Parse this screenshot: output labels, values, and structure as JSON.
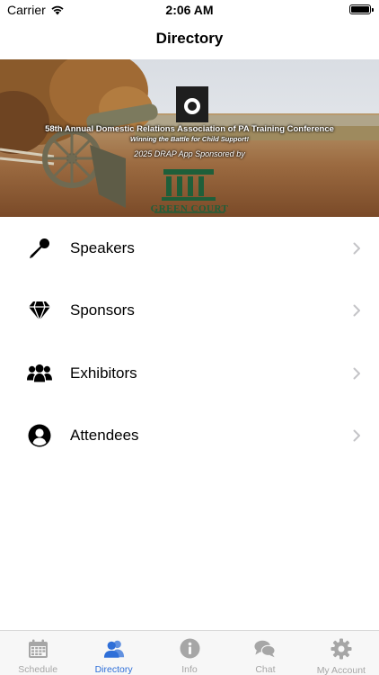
{
  "status_bar": {
    "carrier": "Carrier",
    "time": "2:06 AM"
  },
  "nav": {
    "title": "Directory"
  },
  "banner": {
    "title": "58th Annual Domestic Relations Association of PA Training Conference",
    "subtitle": "Winning the Battle for Child Support!",
    "sponsor_line": "2025 DRAP App Sponsored by",
    "sponsor_name": "GREEN COURT"
  },
  "directory": {
    "items": [
      {
        "label": "Speakers",
        "icon": "microphone-icon"
      },
      {
        "label": "Sponsors",
        "icon": "diamond-icon"
      },
      {
        "label": "Exhibitors",
        "icon": "people-icon"
      },
      {
        "label": "Attendees",
        "icon": "user-circle-icon"
      }
    ]
  },
  "tab_bar": {
    "active_color": "#2f6fd8",
    "inactive_color": "#a6a6a6",
    "tabs": [
      {
        "label": "Schedule",
        "icon": "calendar-icon",
        "active": false
      },
      {
        "label": "Directory",
        "icon": "people-icon",
        "active": true
      },
      {
        "label": "Info",
        "icon": "info-icon",
        "active": false
      },
      {
        "label": "Chat",
        "icon": "chat-bubbles-icon",
        "active": false
      },
      {
        "label": "My Account",
        "icon": "gear-icon",
        "active": false
      }
    ]
  }
}
